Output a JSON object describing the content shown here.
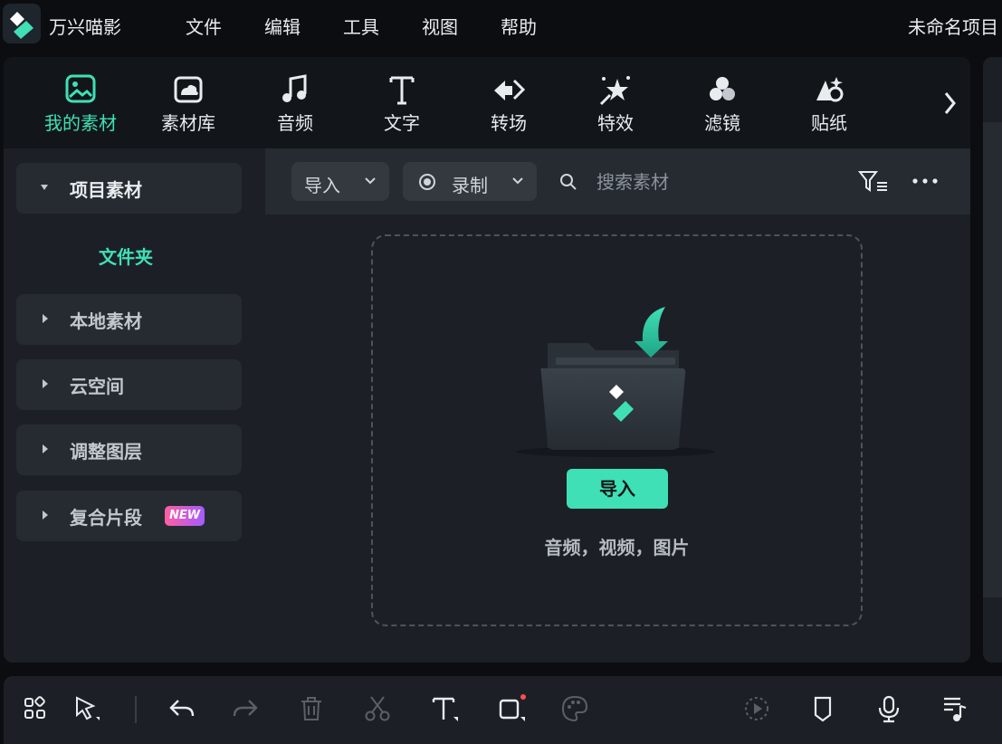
{
  "app": {
    "name": "万兴喵影",
    "project_name": "未命名项目"
  },
  "menu": [
    "文件",
    "编辑",
    "工具",
    "视图",
    "帮助"
  ],
  "tabs": [
    {
      "label": "我的素材",
      "icon": "my-media-icon",
      "active": true
    },
    {
      "label": "素材库",
      "icon": "stock-library-icon",
      "active": false
    },
    {
      "label": "音频",
      "icon": "music-note-icon",
      "active": false
    },
    {
      "label": "文字",
      "icon": "text-t-icon",
      "active": false
    },
    {
      "label": "转场",
      "icon": "transition-arrows-icon",
      "active": false
    },
    {
      "label": "特效",
      "icon": "effects-star-icon",
      "active": false
    },
    {
      "label": "滤镜",
      "icon": "filter-circles-icon",
      "active": false
    },
    {
      "label": "贴纸",
      "icon": "sticker-icon",
      "active": false
    }
  ],
  "sidebar": {
    "project_media": "项目素材",
    "folder": "文件夹",
    "local_media": "本地素材",
    "cloud_space": "云空间",
    "adjustment_layer": "调整图层",
    "compound_clip": "复合片段",
    "new_badge": "NEW"
  },
  "toolbar": {
    "import_label": "导入",
    "record_label": "录制",
    "search_placeholder": "搜索素材"
  },
  "dropzone": {
    "import_button": "导入",
    "hint": "音频，视频，图片"
  },
  "colors": {
    "accent": "#3fe0b5",
    "background": "#0b0d10",
    "panel": "#1c2026",
    "new_badge_start": "#ff5fa3",
    "new_badge_end": "#a35bff",
    "record_dot": "#ff4d4d"
  },
  "bottom_toolbar": [
    "layout-grid-icon",
    "select-arrow-icon",
    "undo-icon",
    "redo-icon",
    "delete-icon",
    "scissors-icon",
    "text-tool-icon",
    "crop-icon",
    "color-palette-icon",
    "render-preview-icon",
    "marker-icon",
    "microphone-icon",
    "audio-list-icon"
  ]
}
